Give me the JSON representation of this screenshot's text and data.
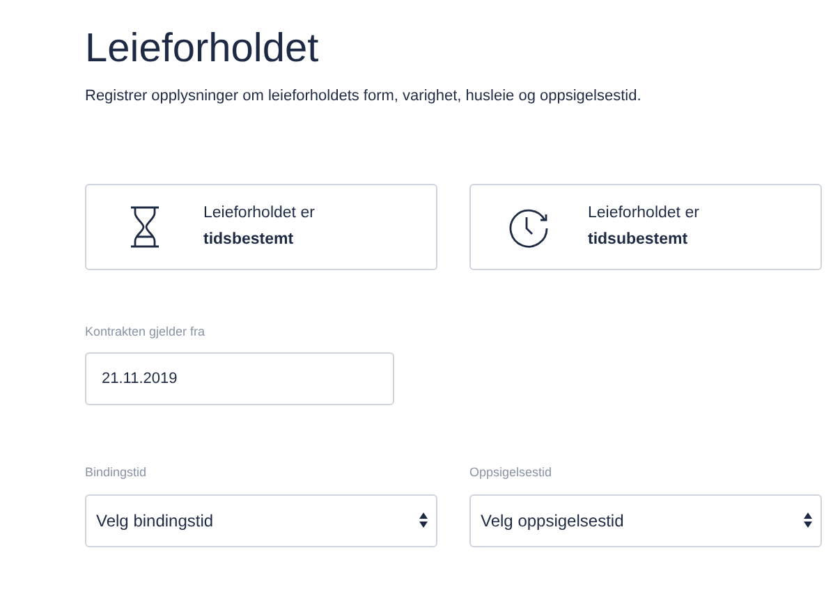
{
  "title": "Leieforholdet",
  "subtitle": "Registrer opplysninger om leieforholdets form, varighet, husleie og oppsigelsestid.",
  "options": [
    {
      "kind": "hourglass",
      "label": "Leieforholdet er **tidsbestemt**",
      "selected": false
    },
    {
      "kind": "clock",
      "label": "Leieforholdet er **tidsubestemt**",
      "selected": false
    }
  ],
  "start_date": {
    "label": "Kontrakten gjelder fra",
    "value": "21.11.2019"
  },
  "selects": [
    {
      "label": "Bindingstid",
      "value": "Velg bindingstid"
    },
    {
      "label": "Oppsigelsestid",
      "value": "Velg oppsigelsestid"
    }
  ]
}
